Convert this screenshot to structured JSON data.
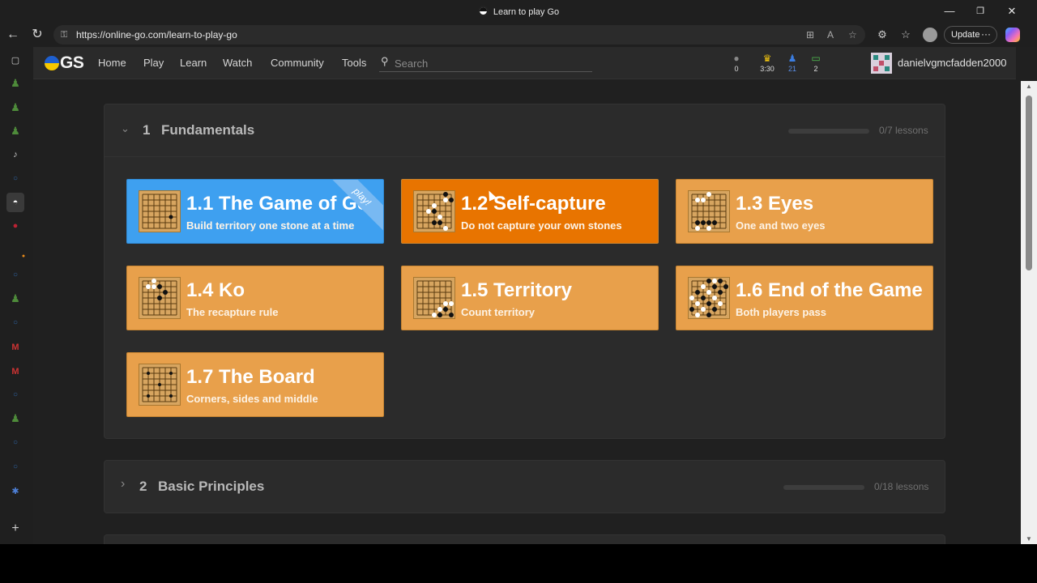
{
  "window": {
    "title": "Learn to play Go",
    "minimize": "—",
    "restore": "❐",
    "close": "✕"
  },
  "browser": {
    "url": "https://online-go.com/learn-to-play-go",
    "update_label": "Update",
    "more": "···"
  },
  "nav": {
    "logo": "GS",
    "links": [
      "Home",
      "Play",
      "Learn",
      "Watch",
      "Community",
      "Tools"
    ],
    "search_placeholder": "Search",
    "stats": {
      "chat": "0",
      "tournament": "3:30",
      "notifications": "21",
      "games": "2"
    },
    "username": "danielvgmcfadden2000"
  },
  "colors": {
    "card_orange": "#e8a04b",
    "card_selected": "#e87400",
    "card_playing": "#3ea0f0",
    "section_bg": "#2b2b2b"
  },
  "sections": [
    {
      "number": "1",
      "name": "Fundamentals",
      "progress": "0/7 lessons",
      "progress_fraction": 0,
      "expanded": true,
      "lessons": [
        {
          "title": "1.1 The Game of Go",
          "subtitle": "Build territory one stone at a time",
          "badge": "play!",
          "state": "playing"
        },
        {
          "title": "1.2 Self-capture",
          "subtitle": "Do not capture your own stones",
          "state": "hover"
        },
        {
          "title": "1.3 Eyes",
          "subtitle": "One and two eyes",
          "state": "normal"
        },
        {
          "title": "1.4 Ko",
          "subtitle": "The recapture rule",
          "state": "normal"
        },
        {
          "title": "1.5 Territory",
          "subtitle": "Count territory",
          "state": "normal"
        },
        {
          "title": "1.6 End of the Game",
          "subtitle": "Both players pass",
          "state": "normal"
        },
        {
          "title": "1.7 The Board",
          "subtitle": "Corners, sides and middle",
          "state": "normal"
        }
      ]
    },
    {
      "number": "2",
      "name": "Basic Principles",
      "progress": "0/18 lessons",
      "progress_fraction": 0,
      "expanded": false
    }
  ],
  "icons": {
    "back": "←",
    "refresh": "↻",
    "lock": "⚿",
    "star": "☆",
    "collapse": "⌄",
    "expand": "›",
    "search": "⚲",
    "add": "+"
  }
}
